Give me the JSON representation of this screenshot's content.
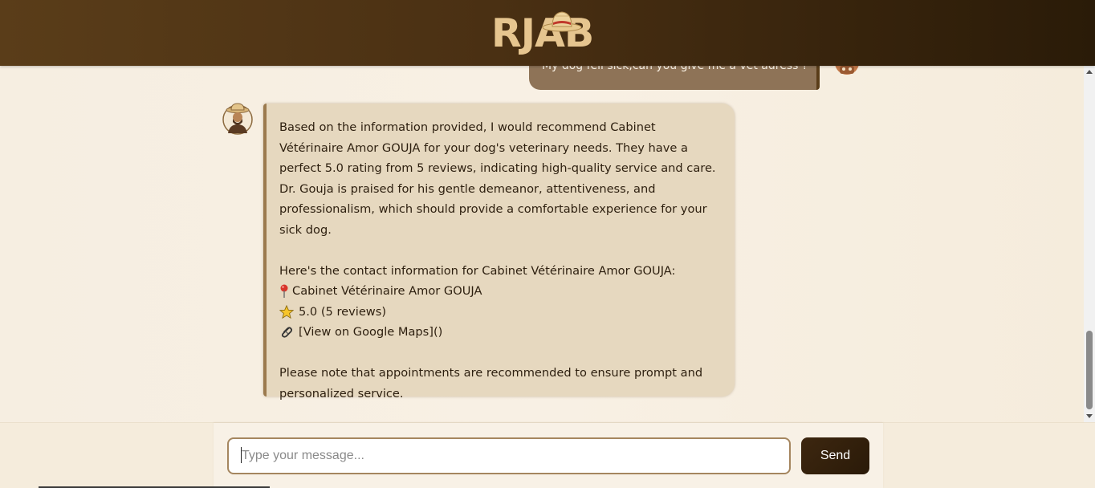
{
  "header": {
    "logo_text": "RJAB"
  },
  "conversation": {
    "user_message": "My dog fell sick,can you give me a vet adress ?",
    "bot_message": {
      "paragraph_1": "Based on the information provided, I would recommend Cabinet Vétérinaire Amor GOUJA for your dog's veterinary needs. They have a perfect 5.0 rating from 5 reviews, indicating high-quality service and care. Dr. Gouja is praised for his gentle demeanor, attentiveness, and professionalism, which should provide a comfortable experience for your sick dog.",
      "contact_intro": "Here's the contact information for Cabinet Vétérinaire Amor GOUJA:",
      "place_name": "Cabinet Vétérinaire Amor GOUJA",
      "rating": "5.0 (5 reviews)",
      "maps_link": "[View on Google Maps]()",
      "closing": "Please note that appointments are recommended to ensure prompt and personalized service."
    },
    "icons": {
      "place": "round-pushpin-icon",
      "rating": "star-icon",
      "link": "paperclip-icon"
    }
  },
  "composer": {
    "input_placeholder": "Type your message...",
    "input_value": "",
    "send_label": "Send"
  },
  "colors": {
    "header_bg": "#4a3013",
    "logo": "#e6c58f",
    "user_bubble": "#8e7357",
    "bot_bubble": "#e6d8bf",
    "send_button": "#2a1a08"
  }
}
